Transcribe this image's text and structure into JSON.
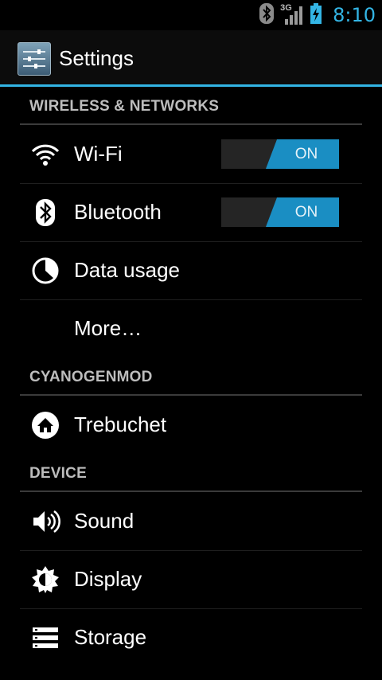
{
  "status_bar": {
    "network_label": "3G",
    "time": "8:10",
    "icons": [
      "bluetooth-icon",
      "signal-icon",
      "battery-charging-icon"
    ],
    "accent": "#33b5e5"
  },
  "action_bar": {
    "title": "Settings",
    "icon": "settings-app-icon"
  },
  "sections": [
    {
      "header": "WIRELESS & NETWORKS",
      "items": [
        {
          "label": "Wi-Fi",
          "icon": "wifi-icon",
          "toggle": "ON"
        },
        {
          "label": "Bluetooth",
          "icon": "bluetooth-icon",
          "toggle": "ON"
        },
        {
          "label": "Data usage",
          "icon": "data-usage-icon"
        },
        {
          "label": "More…"
        }
      ]
    },
    {
      "header": "CYANOGENMOD",
      "items": [
        {
          "label": "Trebuchet",
          "icon": "launcher-home-icon"
        }
      ]
    },
    {
      "header": "DEVICE",
      "items": [
        {
          "label": "Sound",
          "icon": "sound-icon"
        },
        {
          "label": "Display",
          "icon": "display-brightness-icon"
        },
        {
          "label": "Storage",
          "icon": "storage-icon"
        }
      ]
    }
  ]
}
